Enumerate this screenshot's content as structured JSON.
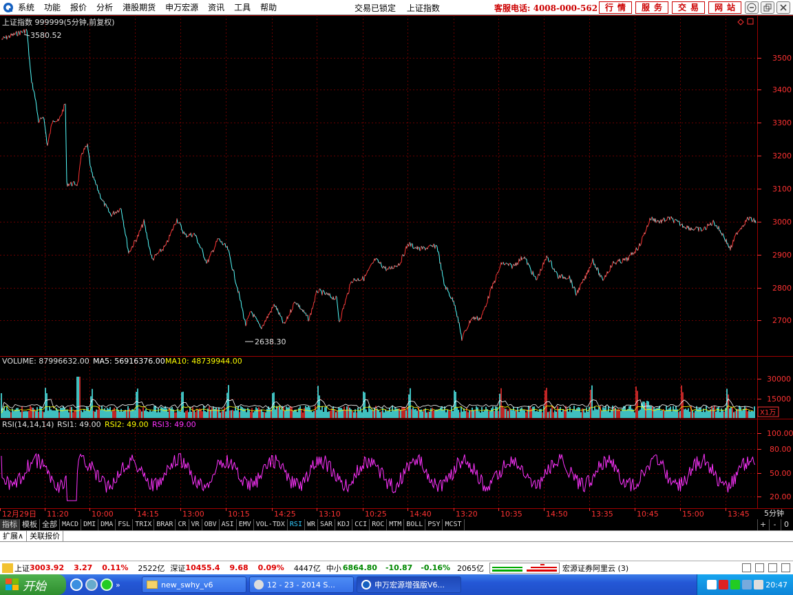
{
  "menubar": {
    "items": [
      "系统",
      "功能",
      "报价",
      "分析",
      "港股期货",
      "申万宏源",
      "资讯",
      "工具",
      "帮助"
    ],
    "status_locked": "交易已锁定",
    "current_symbol": "上证指数",
    "hotline": "客服电话: 4008-000-562",
    "nav_buttons": [
      "行情",
      "服务",
      "交易",
      "网站"
    ]
  },
  "price_panel": {
    "title": "上证指数 999999(5分钟,前复权)",
    "max_label": "3580.52",
    "min_label": "2638.30",
    "y_ticks": [
      "3500",
      "3400",
      "3300",
      "3200",
      "3100",
      "3000",
      "2900",
      "2800",
      "2700"
    ]
  },
  "volume_panel": {
    "label": "VOLUME: 87996632.00",
    "ma5": "MA5: 56916376.00",
    "ma10": "MA10: 48739944.00",
    "y_ticks": [
      "30000",
      "15000"
    ],
    "unit": "X1万"
  },
  "rsi_panel": {
    "label": "RSI(14,14,14)",
    "rsi1": "RSI1: 49.00",
    "rsi2": "RSI2: 49.00",
    "rsi3": "RSI3: 49.00",
    "y_ticks": [
      "100.00",
      "80.00",
      "50.00",
      "20.00"
    ]
  },
  "time_axis": {
    "labels": [
      "12月29日",
      "11:20",
      "10:00",
      "14:15",
      "13:00",
      "10:15",
      "14:25",
      "13:10",
      "10:25",
      "14:40",
      "13:20",
      "10:35",
      "14:50",
      "13:35",
      "10:45",
      "15:00",
      "13:45"
    ],
    "period": "5分钟"
  },
  "indicator_tabs": [
    "指标",
    "模板",
    "全部",
    "MACD",
    "DMI",
    "DMA",
    "FSL",
    "TRIX",
    "BRAR",
    "CR",
    "VR",
    "OBV",
    "ASI",
    "EMV",
    "VOL-TDX",
    "RSI",
    "WR",
    "SAR",
    "KDJ",
    "CCI",
    "ROC",
    "MTM",
    "BOLL",
    "PSY",
    "MCST"
  ],
  "indicator_active": "RSI",
  "tab_controls": [
    "+",
    "-",
    "0"
  ],
  "sub_tabs": [
    "扩展∧",
    "关联报价"
  ],
  "statusbar": {
    "sh_name": "上证",
    "sh_value": "3003.92",
    "sh_change": "3.27",
    "sh_pct": "0.11%",
    "sh_amount": "2522亿",
    "sz_name": "深证",
    "sz_value": "10455.4",
    "sz_change": "9.68",
    "sz_pct": "0.09%",
    "sz_amount": "4447亿",
    "zx_name": "中小",
    "zx_value": "6864.80",
    "zx_change": "-10.87",
    "zx_pct": "-0.16%",
    "zx_amount": "2065亿",
    "server": "宏源证券阿里云 (3)"
  },
  "taskbar": {
    "start": "开始",
    "items": [
      "new_swhy_v6",
      "12 - 23 - 2014 S...",
      "申万宏源增强版V6..."
    ],
    "clock": "20:47"
  },
  "colors": {
    "up": "#ff3232",
    "down": "#54ffff",
    "rsi": "#ff33ff",
    "ma5": "#ffffff",
    "ma10": "#ffff00",
    "grid": "#8b0000"
  }
}
